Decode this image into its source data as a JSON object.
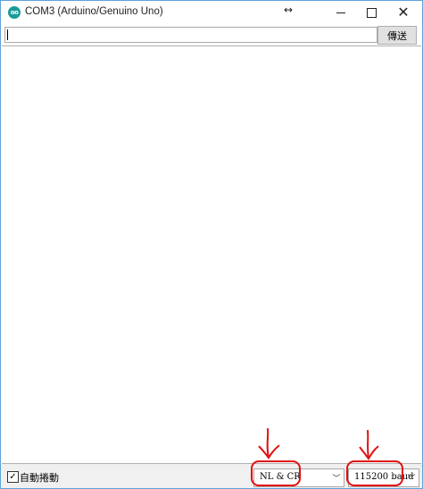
{
  "window": {
    "title": "COM3 (Arduino/Genuino Uno)",
    "icon_label": "oo",
    "resize_glyph": "↔",
    "close_glyph": "✕"
  },
  "send_row": {
    "input_value": "",
    "send_label": "傳送"
  },
  "bottom_bar": {
    "autoscroll_label": "自動捲動",
    "autoscroll_checked": true,
    "line_ending_value": "NL & CR",
    "baud_value": "115200 baud"
  },
  "annotations": {
    "color": "#e01010",
    "description_icons": [
      "down-arrow-icon",
      "down-arrow-icon"
    ]
  }
}
